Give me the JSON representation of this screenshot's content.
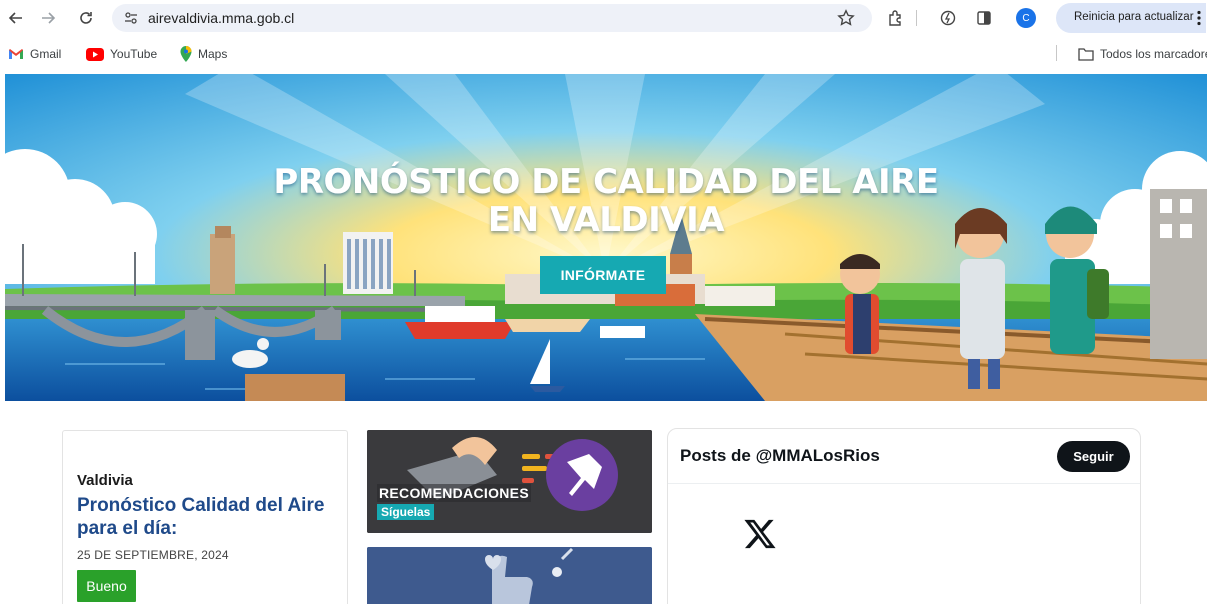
{
  "browser": {
    "url": "airevaldivia.mma.gob.cl",
    "profile_initial": "C",
    "update_label": "Reinicia para actualizar",
    "bookmarks": [
      {
        "label": "Gmail",
        "icon": "gmail-icon"
      },
      {
        "label": "YouTube",
        "icon": "youtube-icon"
      },
      {
        "label": "Maps",
        "icon": "maps-icon"
      }
    ],
    "all_bookmarks_label": "Todos los marcadores",
    "icons": [
      "back-arrow-icon",
      "forward-arrow-icon",
      "reload-icon",
      "site-info-icon",
      "star-icon",
      "extensions-icon",
      "performance-icon",
      "side-panel-icon",
      "kebab-menu-icon"
    ]
  },
  "hero": {
    "title_line1": "PRONÓSTICO DE CALIDAD DEL AIRE",
    "title_line2": "EN VALDIVIA",
    "button_label": "INFÓRMATE"
  },
  "forecast": {
    "city": "Valdivia",
    "heading": "Pronóstico Calidad del Aire para el día:",
    "date": "25 DE SEPTIEMBRE, 2024",
    "status": "Bueno",
    "status_color": "#2aa12a"
  },
  "promos": [
    {
      "title": "RECOMENDACIONES",
      "subtitle": "Síguelas"
    }
  ],
  "twitter": {
    "title": "Posts de @MMALosRios",
    "follow_label": "Seguir"
  },
  "colors": {
    "accent_teal": "#16a9b2",
    "heading_blue": "#1f4a8a"
  }
}
